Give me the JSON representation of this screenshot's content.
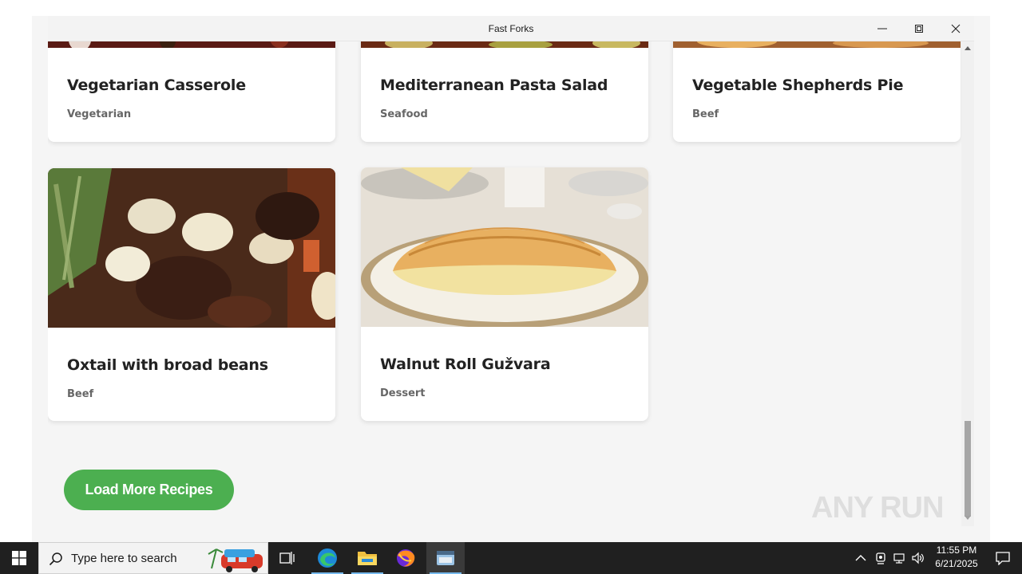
{
  "window": {
    "title": "Fast Forks"
  },
  "recipes": [
    {
      "title": "Vegetarian Casserole",
      "category": "Vegetarian"
    },
    {
      "title": "Mediterranean Pasta Salad",
      "category": "Seafood"
    },
    {
      "title": "Vegetable Shepherds Pie",
      "category": "Beef"
    },
    {
      "title": "Oxtail with broad beans",
      "category": "Beef"
    },
    {
      "title": "Walnut Roll Gužvara",
      "category": "Dessert"
    }
  ],
  "actions": {
    "load_more_label": "Load More Recipes"
  },
  "watermark": {
    "text": "ANY RUN"
  },
  "taskbar": {
    "search_placeholder": "Type here to search",
    "clock_time": "11:55 PM",
    "clock_date": "6/21/2025"
  },
  "colors": {
    "accent_green": "#4caf50",
    "taskbar_bg": "#202020",
    "content_bg": "#f5f5f5"
  },
  "icons": [
    "minimize-icon",
    "maximize-icon",
    "close-icon",
    "windows-start-icon",
    "search-icon",
    "task-view-icon",
    "edge-icon",
    "file-explorer-icon",
    "firefox-icon",
    "app-icon",
    "chevron-up-icon",
    "network-icon",
    "wifi-icon",
    "volume-icon",
    "notification-icon"
  ]
}
